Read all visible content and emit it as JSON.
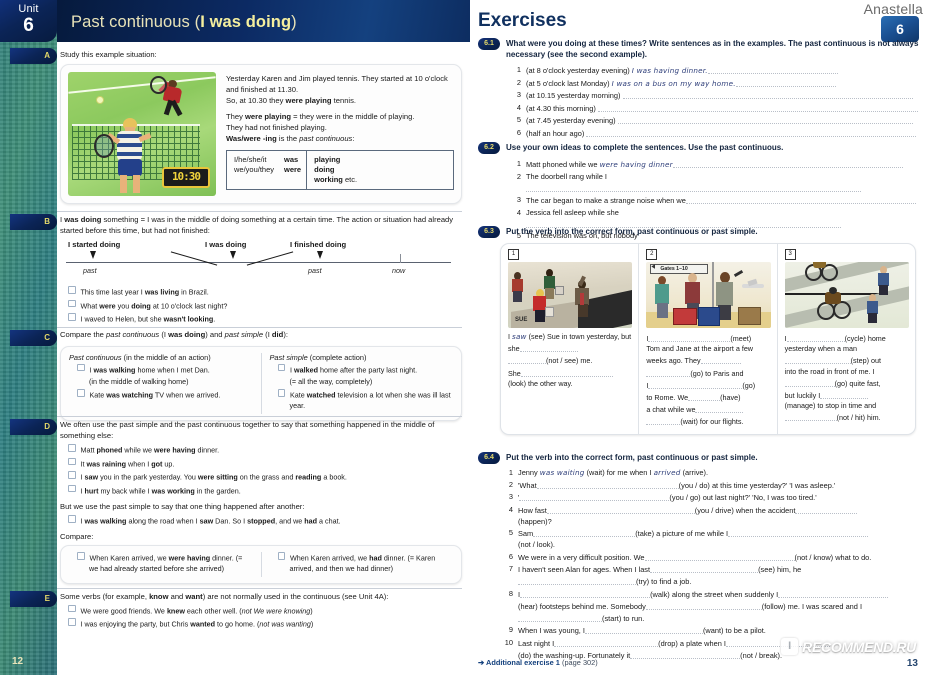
{
  "left": {
    "unit_label": "Unit",
    "unit_number": "6",
    "title_plain": "Past continuous (",
    "title_bold": "I was doing",
    "title_close": ")",
    "page_number": "12",
    "sections": [
      {
        "letter": "A"
      },
      {
        "letter": "B"
      },
      {
        "letter": "C"
      },
      {
        "letter": "D"
      },
      {
        "letter": "E"
      }
    ],
    "section_a": {
      "intro": "Study this example situation:",
      "clock_time": "10:30",
      "para1": "Yesterday Karen and Jim played tennis.  They started at 10 o'clock and finished at 11.30.",
      "para1b": "So, at 10.30 they ",
      "para1b_bold": "were playing",
      "para1b_end": " tennis.",
      "para2_lead": "They ",
      "para2_bold": "were playing",
      "para2_rest": " = they were in the middle of playing.",
      "para2_line2": "They had not finished playing.",
      "para3_bold": "Was/were -ing",
      "para3_rest": " is the ",
      "para3_ital": "past continuous",
      "para3_end": ":",
      "table": {
        "row1_pronoun": "I/he/she/it",
        "row1_aux": "was",
        "row2_pronoun": "we/you/they",
        "row2_aux": "were",
        "verbs": [
          "playing",
          "doing",
          "working"
        ],
        "etc": "etc."
      }
    },
    "section_b": {
      "lead_a": "I ",
      "lead_bold": "was doing",
      "lead_b": " something = I was in the middle of doing something at a certain time.  The action or situation had already started before this time, but had not finished:",
      "timeline": {
        "label_start": "I started doing",
        "label_mid": "I was doing",
        "label_end": "I finished doing",
        "sub_past_left": "past",
        "sub_past_right": "past",
        "sub_now": "now"
      },
      "bullets": [
        {
          "pre": "This time last year I ",
          "bold": "was living",
          "post": " in Brazil."
        },
        {
          "pre": "What ",
          "bold": "were",
          "mid": " you ",
          "bold2": "doing",
          "post": " at 10 o'clock last night?"
        },
        {
          "pre": "I waved to Helen, but she ",
          "bold": "wasn't looking",
          "post": "."
        }
      ]
    },
    "section_c": {
      "lead": "Compare the past continuous (I was doing) and past simple (I did):",
      "lead_a": "Compare the ",
      "lead_i1": "past continuous",
      "lead_b1": " (I ",
      "lead_bold1": "was doing",
      "lead_b2": ") and ",
      "lead_i2": "past simple",
      "lead_b3": " (I ",
      "lead_bold2": "did",
      "lead_b4": "):",
      "left_head_i": "Past continuous",
      "left_head_rest": " (in the middle of an action)",
      "right_head_i": "Past simple",
      "right_head_rest": " (complete action)",
      "left_items": [
        {
          "pre": "I ",
          "bold": "was walking",
          "post": " home when I met Dan."
        },
        {
          "plain": "(in the middle of walking home)"
        },
        {
          "pre": "Kate ",
          "bold": "was watching",
          "post": " TV when we arrived."
        }
      ],
      "right_items": [
        {
          "pre": "I ",
          "bold": "walked",
          "post": " home after the party last night."
        },
        {
          "plain": "(= all the way, completely)"
        },
        {
          "pre": "Kate ",
          "bold": "watched",
          "post": " television a lot when she was ill last year."
        }
      ]
    },
    "section_d": {
      "lead": "We often use the past simple and the past continuous together to say that something happened in the middle of something else:",
      "bullets": [
        {
          "pre": "Matt ",
          "bold": "phoned",
          "mid": " while we ",
          "bold2": "were having",
          "post": " dinner."
        },
        {
          "pre": "It ",
          "bold": "was raining",
          "mid": " when I ",
          "bold2": "got",
          "post": " up."
        },
        {
          "pre": "I ",
          "bold": "saw",
          "mid": " you in the park yesterday.  You ",
          "bold2": "were sitting",
          "mid2": " on the grass and ",
          "bold3": "reading",
          "post": " a book."
        },
        {
          "pre": "I ",
          "bold": "hurt",
          "mid": " my back while I ",
          "bold2": "was working",
          "post": " in the garden."
        }
      ],
      "mid_text": "But we use the past simple to say that one thing happened after another:",
      "mid_bullet": {
        "pre": "I ",
        "bold": "was walking",
        "mid": " along the road when I ",
        "bold2": "saw",
        "mid2": " Dan.  So I ",
        "bold3": "stopped",
        "mid3": ", and we ",
        "bold4": "had",
        "post": " a chat."
      },
      "compare_label": "Compare:",
      "compare_left": {
        "pre": "When Karen arrived, we ",
        "bold": "were having",
        "post": " dinner.   (= we had already started before she arrived)"
      },
      "compare_right": {
        "pre": "When Karen arrived, we ",
        "bold": "had",
        "post": " dinner. (= Karen arrived, and then we had dinner)"
      }
    },
    "section_e": {
      "lead_a": "Some verbs (for example, ",
      "lead_b1": "know",
      "lead_mid": " and ",
      "lead_b2": "want",
      "lead_end": ") are not normally used in the continuous (see Unit 4A):",
      "bullets": [
        {
          "pre": "We were good friends.  We ",
          "bold": "knew",
          "post": " each other well.   (",
          "ital": "not We were knowing",
          "post2": ")"
        },
        {
          "pre": "I was enjoying the party, but Chris ",
          "bold": "wanted",
          "post": " to go home.   (",
          "ital": "not was wanting",
          "post2": ")"
        }
      ]
    }
  },
  "right": {
    "exercises_title": "Exercises",
    "watermark_name": "Anastella",
    "unit_number": "6",
    "page_number": "13",
    "watermark_brand": "RECOMMEND.RU",
    "watermark_badge": "I",
    "footer_link": "Additional exercise 1",
    "footer_page": "(page 302)",
    "ex61": {
      "num": "6.1",
      "head": "What were you doing at these times? Write sentences as in the examples. The past continuous is not always necessary (see the second example).",
      "items": [
        {
          "n": "1",
          "prompt": "(at 8 o'clock yesterday evening)",
          "answer": "I was having dinner."
        },
        {
          "n": "2",
          "prompt": "(at 5 o'clock last Monday)",
          "answer": "I was on a bus on my way home."
        },
        {
          "n": "3",
          "prompt": "(at 10.15 yesterday morning)",
          "answer": ""
        },
        {
          "n": "4",
          "prompt": "(at 4.30 this morning)",
          "answer": ""
        },
        {
          "n": "5",
          "prompt": "(at 7.45 yesterday evening)",
          "answer": ""
        },
        {
          "n": "6",
          "prompt": "(half an hour ago)",
          "answer": ""
        }
      ]
    },
    "ex62": {
      "num": "6.2",
      "head": "Use your own ideas to complete the sentences. Use the past continuous.",
      "items": [
        {
          "n": "1",
          "prompt": "Matt phoned while we",
          "answer": "were having dinner"
        },
        {
          "n": "2",
          "prompt": "The doorbell rang while I",
          "answer": ""
        },
        {
          "n": "3",
          "prompt": "The car began to make a strange noise when we",
          "answer": ""
        },
        {
          "n": "4",
          "prompt": "Jessica fell asleep while she",
          "answer": ""
        },
        {
          "n": "5",
          "prompt": "The television was on, but nobody",
          "answer": ""
        }
      ]
    },
    "ex63": {
      "num": "6.3",
      "head": "Put the verb into the correct form, past continuous or past simple.",
      "panels": [
        {
          "n": "1",
          "caption_label": "SUE",
          "text": "I saw (see) Sue in town yesterday, but she (not / see) me. She (look) the other way.",
          "answer": "saw"
        },
        {
          "n": "2",
          "sign": "Gates 1–10",
          "text": "I (meet) Tom and Jane at the airport a few weeks ago. They (go) to Paris and I (go) to Rome.  We (have) a chat while we (wait) for our flights."
        },
        {
          "n": "3",
          "text": "I (cycle) home yesterday when a man (step) out into the road in front of me.  I (go) quite fast, but luckily I (manage) to stop in time and (not / hit) him."
        }
      ]
    },
    "ex64": {
      "num": "6.4",
      "head": "Put the verb into the correct form, past continuous or past simple.",
      "items": [
        {
          "n": "1",
          "a": "Jenny",
          "hw1": "was waiting",
          "b": "(wait) for me when I",
          "hw2": "arrived",
          "c": "(arrive)."
        },
        {
          "n": "2",
          "a": "'What",
          "b": "(you / do) at this time yesterday?'  'I was asleep.'"
        },
        {
          "n": "3",
          "a": "'",
          "b": "(you / go) out last night?'  'No, I was too tired.'"
        },
        {
          "n": "4",
          "a": "How fast",
          "b": "(you / drive) when the accident",
          "c2": "(happen)?"
        },
        {
          "n": "5",
          "a": "Sam",
          "b": "(take) a picture of me while I",
          "c2": "(not / look)."
        },
        {
          "n": "6",
          "a": "We were in a very difficult position.  We",
          "b": "(not / know) what to do."
        },
        {
          "n": "7",
          "a": "I haven't seen Alan for ages.  When I last",
          "b": "(see) him, he",
          "c2": "(try) to find a job."
        },
        {
          "n": "8",
          "a": "I",
          "b": "(walk) along the street when suddenly I",
          "c2": "(hear) footsteps behind me.  Somebody",
          "d": "(follow) me.  I was scared and I",
          "e": "(start) to run."
        },
        {
          "n": "9",
          "a": "When I was young, I",
          "b": "(want) to be a pilot."
        },
        {
          "n": "10",
          "a": "Last night I",
          "b": "(drop) a plate when I",
          "c2": "(do) the washing-up.  Fortunately it",
          "d": "(not / break)."
        }
      ]
    }
  }
}
